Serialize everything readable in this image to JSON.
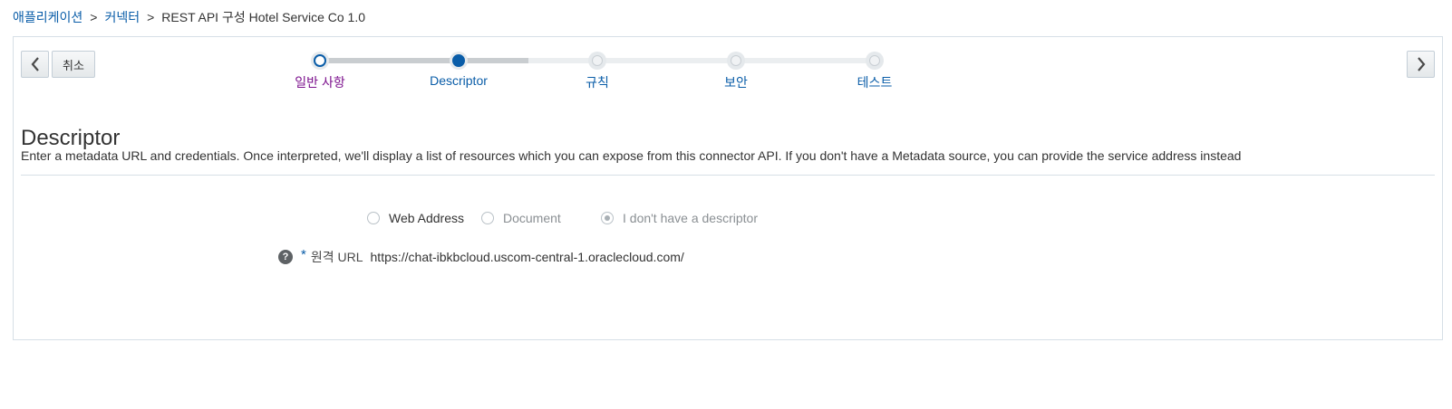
{
  "breadcrumb": {
    "items": [
      "애플리케이션",
      "커넥터"
    ],
    "separator": ">",
    "current": "REST API 구성  Hotel Service Co 1.0"
  },
  "toolbar": {
    "cancel_label": "취소"
  },
  "train": {
    "stops": [
      {
        "label": "일반 사항",
        "state": "visited"
      },
      {
        "label": "Descriptor",
        "state": "current"
      },
      {
        "label": "규칙",
        "state": "unvisited"
      },
      {
        "label": "보안",
        "state": "unvisited"
      },
      {
        "label": "테스트",
        "state": "unvisited"
      }
    ]
  },
  "section": {
    "title": "Descriptor",
    "description": "Enter a metadata URL and credentials. Once interpreted, we'll display a list of resources which you can expose from this connector API. If you don't have a Metadata source, you can provide the service address instead"
  },
  "descriptor_type": {
    "options": [
      {
        "label": "Web Address",
        "checked": false,
        "enabled": true
      },
      {
        "label": "Document",
        "checked": false,
        "enabled": false
      },
      {
        "label": "I don't have a descriptor",
        "checked": true,
        "enabled": false
      }
    ]
  },
  "remote_url": {
    "help_glyph": "?",
    "required_mark": "*",
    "label": "원격 URL",
    "value": "https://chat-ibkbcloud.uscom-central-1.oraclecloud.com/"
  },
  "colors": {
    "link": "#0a5da8",
    "visited": "#7b0f8c",
    "border": "#d6dfe6"
  },
  "icons": {
    "prev": "chevron-left-icon",
    "next": "chevron-right-icon",
    "help": "help-icon"
  }
}
